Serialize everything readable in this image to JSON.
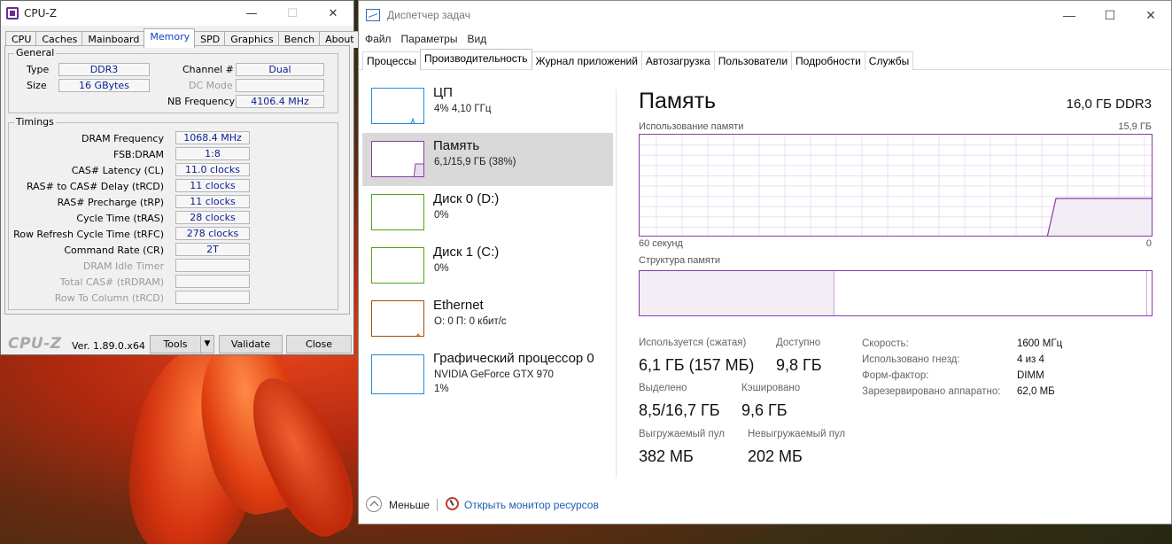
{
  "cpuz": {
    "title": "CPU-Z",
    "tabs": [
      "CPU",
      "Caches",
      "Mainboard",
      "Memory",
      "SPD",
      "Graphics",
      "Bench",
      "About"
    ],
    "active_tab": "Memory",
    "general": {
      "title": "General",
      "type_label": "Type",
      "type_value": "DDR3",
      "size_label": "Size",
      "size_value": "16 GBytes",
      "channel_label": "Channel #",
      "channel_value": "Dual",
      "dc_mode_label": "DC Mode",
      "dc_mode_value": "",
      "nb_freq_label": "NB Frequency",
      "nb_freq_value": "4106.4 MHz"
    },
    "timings": {
      "title": "Timings",
      "rows": [
        {
          "label": "DRAM Frequency",
          "value": "1068.4 MHz"
        },
        {
          "label": "FSB:DRAM",
          "value": "1:8"
        },
        {
          "label": "CAS# Latency (CL)",
          "value": "11.0 clocks"
        },
        {
          "label": "RAS# to CAS# Delay (tRCD)",
          "value": "11 clocks"
        },
        {
          "label": "RAS# Precharge (tRP)",
          "value": "11 clocks"
        },
        {
          "label": "Cycle Time (tRAS)",
          "value": "28 clocks"
        },
        {
          "label": "Row Refresh Cycle Time (tRFC)",
          "value": "278 clocks"
        },
        {
          "label": "Command Rate (CR)",
          "value": "2T"
        },
        {
          "label": "DRAM Idle Timer",
          "value": ""
        },
        {
          "label": "Total CAS# (tRDRAM)",
          "value": ""
        },
        {
          "label": "Row To Column (tRCD)",
          "value": ""
        }
      ]
    },
    "footer": {
      "brand": "CPU-Z",
      "version": "Ver. 1.89.0.x64",
      "tools": "Tools",
      "validate": "Validate",
      "close": "Close"
    }
  },
  "taskmgr": {
    "title": "Диспетчер задач",
    "menu": [
      "Файл",
      "Параметры",
      "Вид"
    ],
    "tabs": [
      "Процессы",
      "Производительность",
      "Журнал приложений",
      "Автозагрузка",
      "Пользователи",
      "Подробности",
      "Службы"
    ],
    "active_tab": "Производительность",
    "sidebar": [
      {
        "name": "ЦП",
        "sub": "4% 4,10 ГГц",
        "sub2": "",
        "color": "#1f8dd6"
      },
      {
        "name": "Память",
        "sub": "6,1/15,9 ГБ (38%)",
        "sub2": "",
        "color": "#8b3aa6"
      },
      {
        "name": "Диск 0 (D:)",
        "sub": "0%",
        "sub2": "",
        "color": "#4da60c"
      },
      {
        "name": "Диск 1 (C:)",
        "sub": "0%",
        "sub2": "",
        "color": "#4da60c"
      },
      {
        "name": "Ethernet",
        "sub": "О: 0 П: 0 кбит/с",
        "sub2": "",
        "color": "#a74f01"
      },
      {
        "name": "Графический процессор 0",
        "sub": "NVIDIA GeForce GTX 970",
        "sub2": "1%",
        "color": "#1f8dd6"
      }
    ],
    "main": {
      "title": "Память",
      "capacity": "16,0 ГБ DDR3",
      "usage_caption": "Использование памяти",
      "usage_max": "15,9 ГБ",
      "time_caption": "60 секунд",
      "time_zero": "0",
      "composition_caption": "Структура памяти",
      "in_use_fraction": 0.38,
      "stats": {
        "in_use_label": "Используется (сжатая)",
        "in_use_value": "6,1 ГБ (157 МБ)",
        "available_label": "Доступно",
        "available_value": "9,8 ГБ",
        "committed_label": "Выделено",
        "committed_value": "8,5/16,7 ГБ",
        "cached_label": "Кэшировано",
        "cached_value": "9,6 ГБ",
        "paged_label": "Выгружаемый пул",
        "paged_value": "382 МБ",
        "nonpaged_label": "Невыгружаемый пул",
        "nonpaged_value": "202 МБ"
      },
      "details": [
        {
          "label": "Скорость:",
          "value": "1600 МГц"
        },
        {
          "label": "Использовано гнезд:",
          "value": "4 из 4"
        },
        {
          "label": "Форм-фактор:",
          "value": "DIMM"
        },
        {
          "label": "Зарезервировано аппаратно:",
          "value": "62,0 МБ"
        }
      ]
    },
    "footer": {
      "less": "Меньше",
      "monitor": "Открыть монитор ресурсов"
    }
  }
}
